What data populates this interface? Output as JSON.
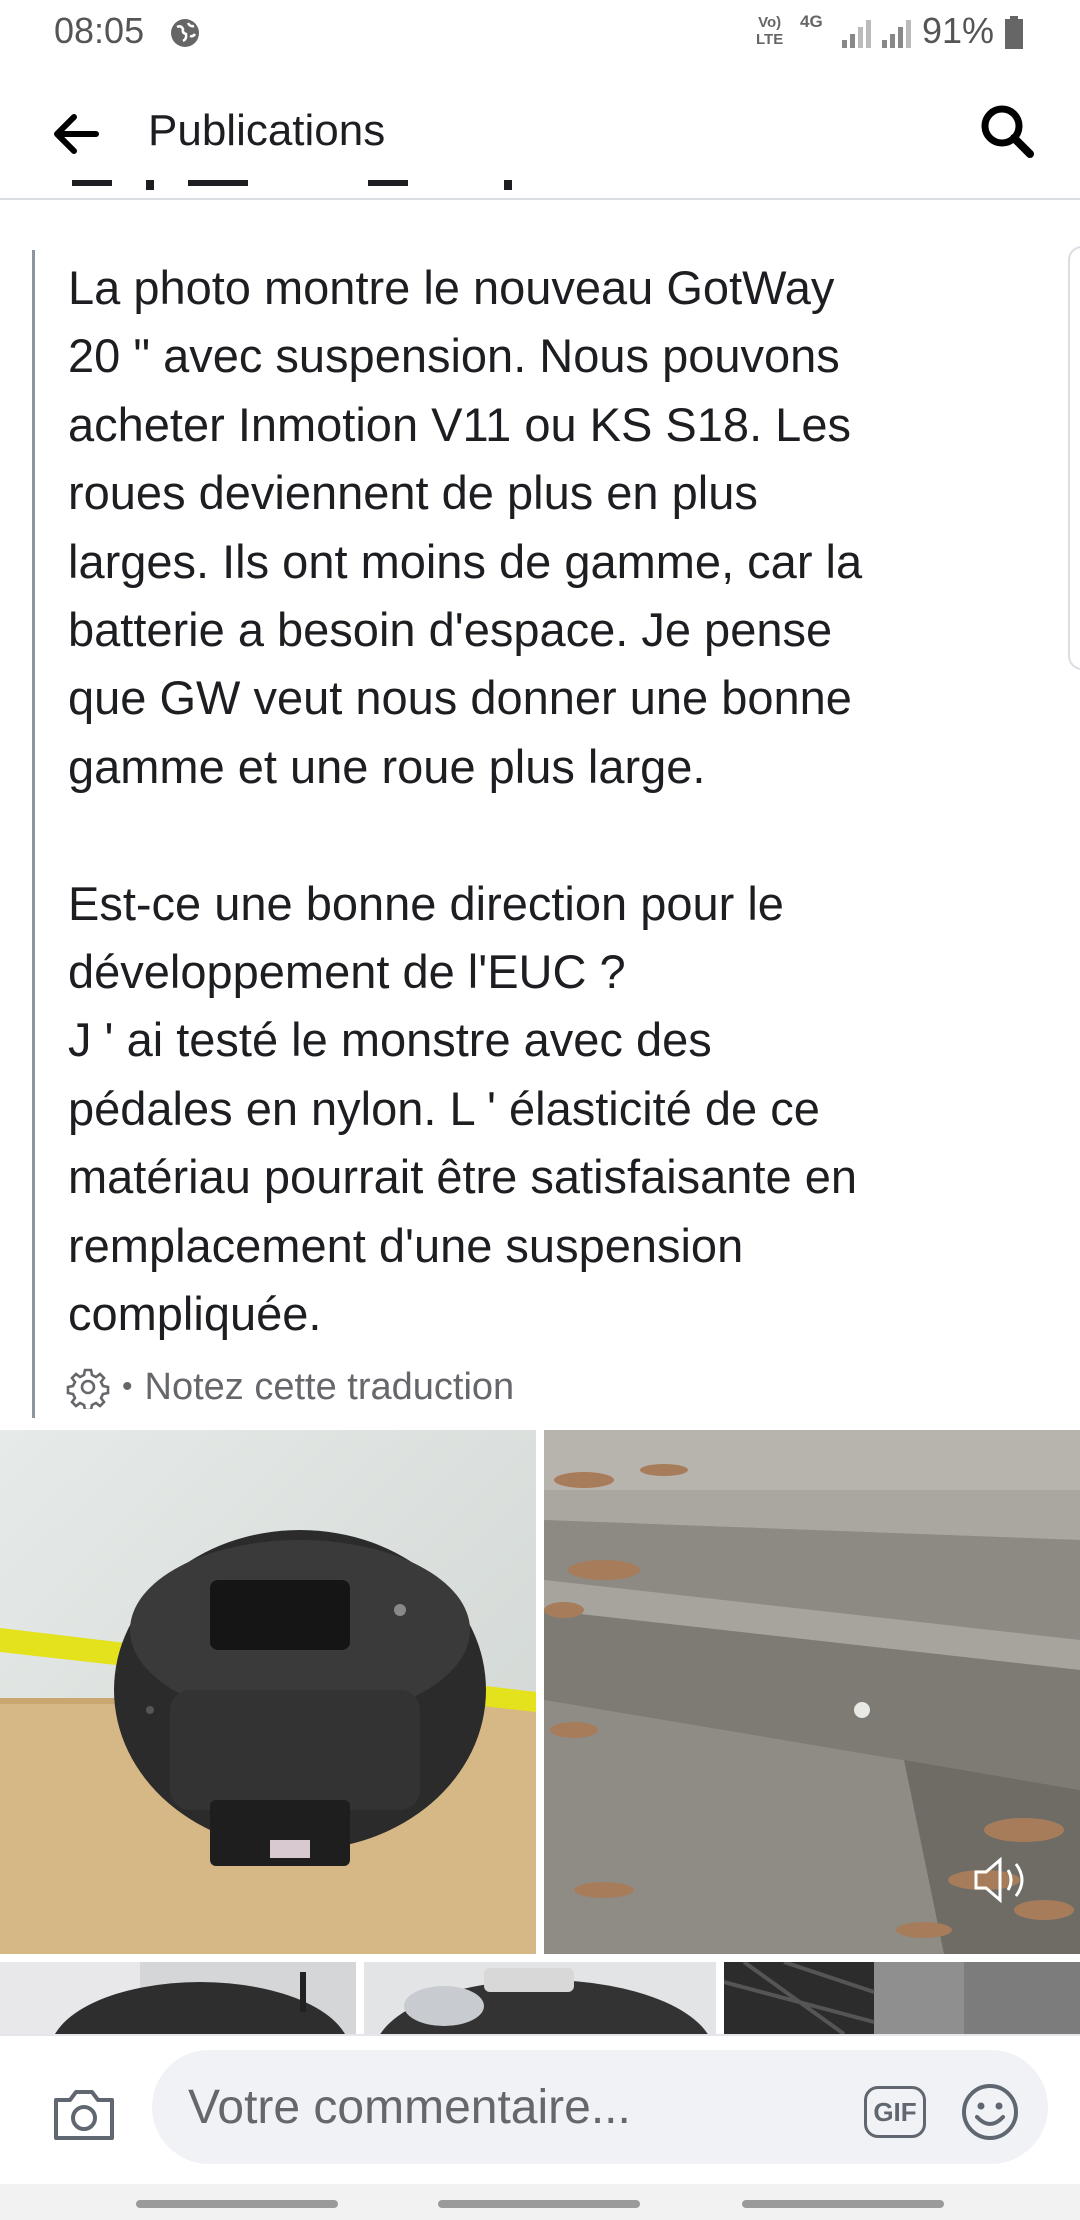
{
  "status_bar": {
    "time": "08:05",
    "volte": "Vo)\nLTE",
    "network": "4G",
    "battery": "91%"
  },
  "header": {
    "title": "Publications",
    "back_icon": "arrow-left-icon",
    "search_icon": "search-icon"
  },
  "post": {
    "text": "La photo montre le nouveau GotWay\n20 \" avec suspension. Nous pouvons\nacheter Inmotion V11 ou KS S18. Les\nroues deviennent de plus en plus\nlarges. Ils ont moins de gamme, car la\nbatterie a besoin d'espace. Je pense\nque GW veut nous donner une bonne\ngamme et une roue plus large.\n\nEst-ce une bonne direction pour le\ndéveloppement de l'EUC ?\nJ ' ai testé le monstre avec des\npédales en nylon. L ' élasticité de ce\nmatériau pourrait être satisfaisante en\nremplacement d'une suspension\ncompliquée.",
    "translation": {
      "separator": "•",
      "rate_label": "Notez cette traduction"
    }
  },
  "composer": {
    "placeholder": "Votre commentaire...",
    "gif_label": "GIF"
  },
  "colors": {
    "text": "#1c1e21",
    "secondary": "#65676b",
    "input_bg": "#f0f2f5"
  }
}
